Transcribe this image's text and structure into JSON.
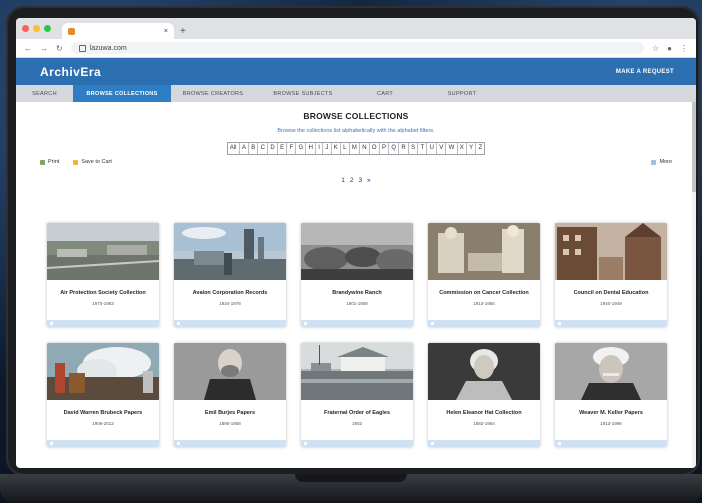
{
  "browser": {
    "tab_title": "",
    "url": "lazuwa.com",
    "newtab_glyph": "+",
    "tab_close_glyph": "×"
  },
  "site": {
    "logo": "ArchivEra",
    "request_button": "MAKE A REQUEST"
  },
  "nav": [
    {
      "label": "SEARCH",
      "active": false
    },
    {
      "label": "BROWSE COLLECTIONS",
      "active": true
    },
    {
      "label": "BROWSE CREATORS",
      "active": false
    },
    {
      "label": "BROWSE SUBJECTS",
      "active": false
    },
    {
      "label": "CART",
      "active": false
    },
    {
      "label": "SUPPORT",
      "active": false
    }
  ],
  "page": {
    "title": "BROWSE COLLECTIONS",
    "subtitle": "Browse the collections list alphabetically with the alphabet filters."
  },
  "alphabet": [
    "All",
    "A",
    "B",
    "C",
    "D",
    "E",
    "F",
    "G",
    "H",
    "I",
    "J",
    "K",
    "L",
    "M",
    "N",
    "O",
    "P",
    "Q",
    "R",
    "S",
    "T",
    "U",
    "V",
    "W",
    "X",
    "Y",
    "Z"
  ],
  "toolbar": {
    "print_label": "Print",
    "save_label": "Save to Cart",
    "more_label": "More"
  },
  "pagination": {
    "pages": [
      "1",
      "2",
      "3"
    ],
    "next": "»"
  },
  "collections": [
    {
      "title": "Air Protection Society Collection",
      "years": "1970-1983",
      "scene": "city-aerial"
    },
    {
      "title": "Avalon Corporation Records",
      "years": "1934-1978",
      "scene": "industrial"
    },
    {
      "title": "Brandywine Ranch",
      "years": "1901-1908",
      "scene": "rocks"
    },
    {
      "title": "Commission on Cancer Collection",
      "years": "1913-1956",
      "scene": "nurses"
    },
    {
      "title": "Council on Dental Education",
      "years": "1940-1949",
      "scene": "buildings"
    },
    {
      "title": "David Warren Brubeck Papers",
      "years": "1906-2012",
      "scene": "steam"
    },
    {
      "title": "Emil Burjes Papers",
      "years": "1890-1958",
      "scene": "portrait-man"
    },
    {
      "title": "Fraternal Order of Eagles",
      "years": "1902",
      "scene": "lake-house"
    },
    {
      "title": "Helen Eleanor Hat Collection",
      "years": "1882-1964",
      "scene": "portrait-woman"
    },
    {
      "title": "Weaver M. Keller Papers",
      "years": "1913-1996",
      "scene": "portrait-old"
    }
  ],
  "colors": {
    "brand_blue": "#2c6fb1",
    "nav_active": "#2f7ec4",
    "nav_bg": "#d4d7db",
    "card_footer": "#cfe2f3"
  }
}
